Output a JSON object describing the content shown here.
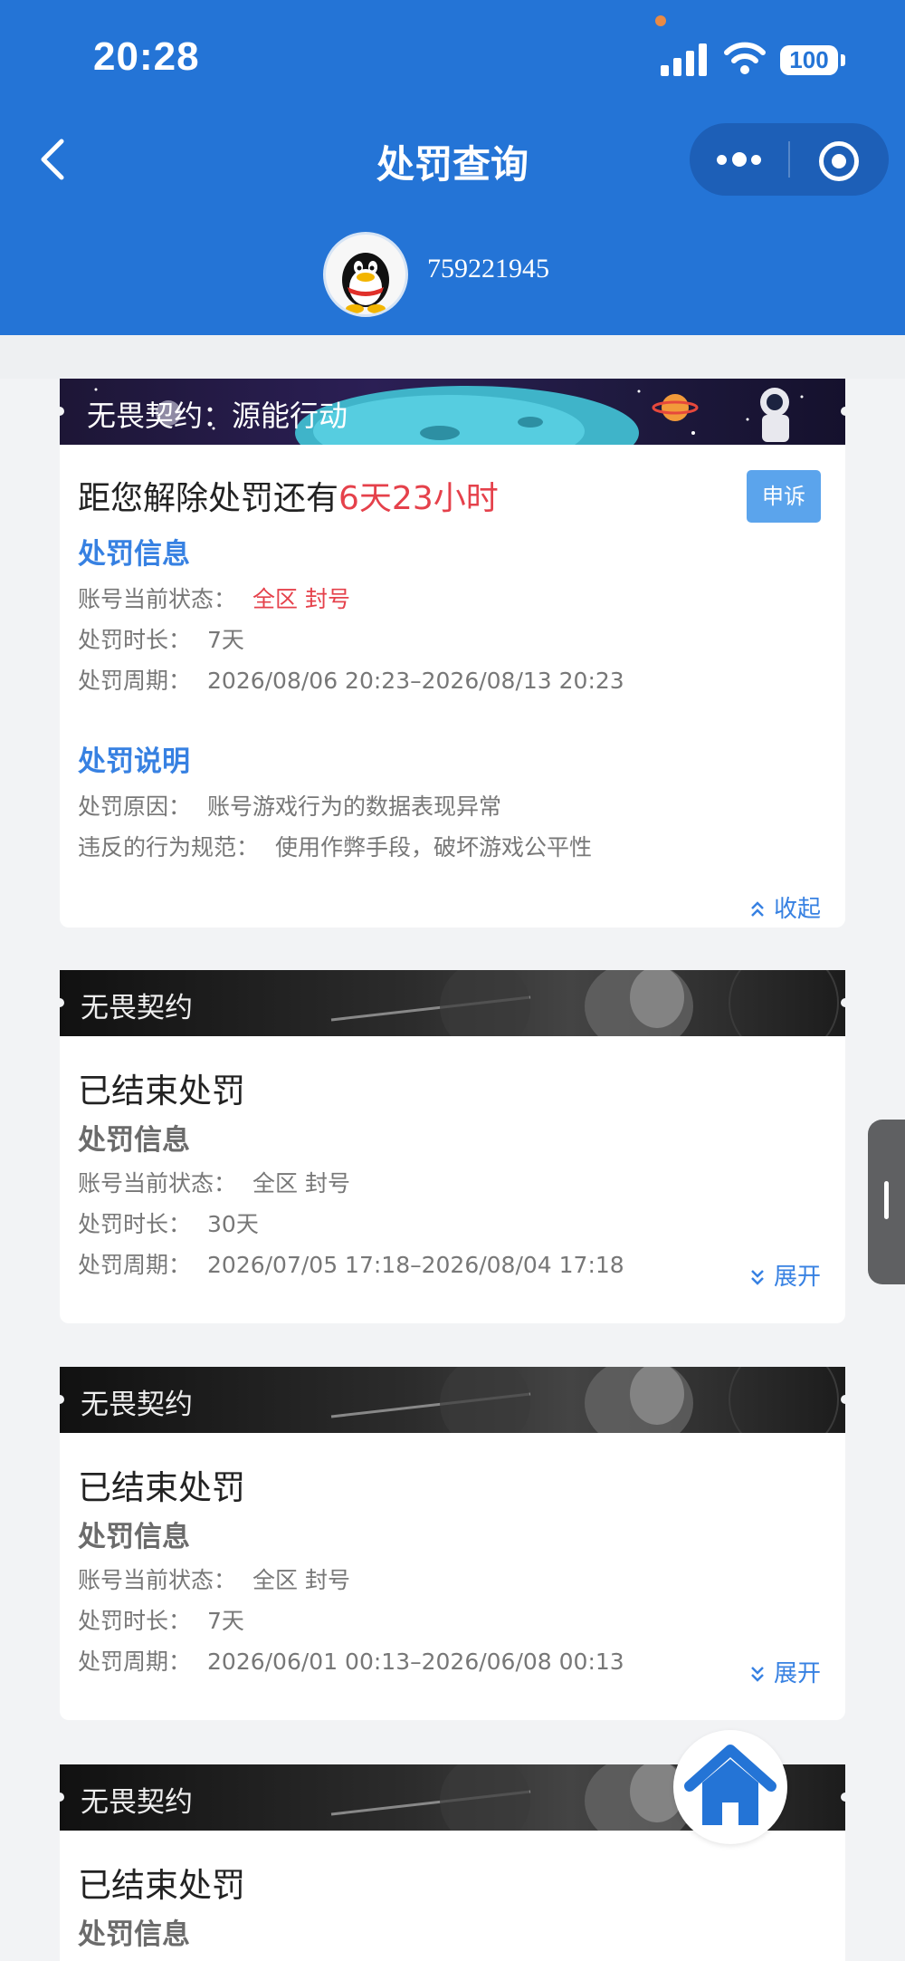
{
  "status_bar": {
    "time": "20:28",
    "battery": "100"
  },
  "nav": {
    "title": "处罚查询"
  },
  "account": {
    "number": "759221945"
  },
  "active_penalty": {
    "banner": "无畏契约：源能行动",
    "countdown_prefix": "距您解除处罚还有",
    "countdown_value": "6天23小时",
    "appeal_label": "申诉",
    "info_heading": "处罚信息",
    "status_label": "账号当前状态：",
    "status_value": "全区 封号",
    "duration_label": "处罚时长：",
    "duration_value": "7天",
    "period_label": "处罚周期：",
    "period_value": "2026/08/06 20:23–2026/08/13 20:23",
    "desc_heading": "处罚说明",
    "reason_label": "处罚原因：",
    "reason_value": "账号游戏行为的数据表现异常",
    "rule_label": "违反的行为规范：",
    "rule_value": "使用作弊手段，破坏游戏公平性",
    "collapse_label": "收起"
  },
  "past_penalties": [
    {
      "banner": "无畏契约",
      "title": "已结束处罚",
      "info_heading": "处罚信息",
      "status_label": "账号当前状态：",
      "status_value": "全区 封号",
      "duration_label": "处罚时长：",
      "duration_value": "30天",
      "period_label": "处罚周期：",
      "period_value": "2026/07/05 17:18–2026/08/04 17:18",
      "expand_label": "展开"
    },
    {
      "banner": "无畏契约",
      "title": "已结束处罚",
      "info_heading": "处罚信息",
      "status_label": "账号当前状态：",
      "status_value": "全区 封号",
      "duration_label": "处罚时长：",
      "duration_value": "7天",
      "period_label": "处罚周期：",
      "period_value": "2026/06/01 00:13–2026/06/08 00:13",
      "expand_label": "展开"
    },
    {
      "banner": "无畏契约",
      "title": "已结束处罚",
      "info_heading": "处罚信息"
    }
  ],
  "colors": {
    "header_blue": "#2474d6",
    "accent_blue": "#3781e2",
    "alert_red": "#e5414b"
  }
}
